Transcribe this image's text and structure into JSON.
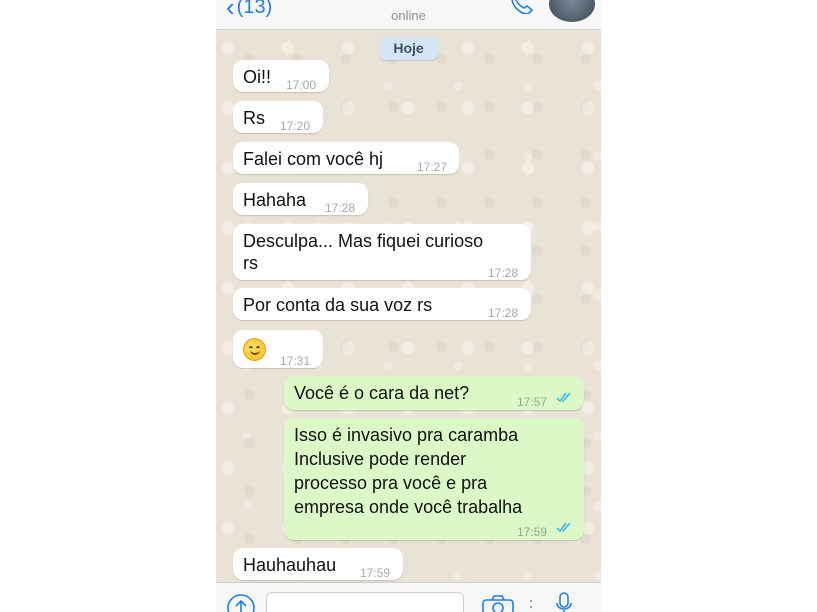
{
  "header": {
    "back_label": "(13)",
    "status": "online",
    "call_icon": "phone-icon",
    "avatar_icon": "contact-avatar"
  },
  "date_separator": "Hoje",
  "messages": [
    {
      "dir": "in",
      "lines": [
        "Oi!!"
      ],
      "time": "17:00"
    },
    {
      "dir": "in",
      "lines": [
        "Rs"
      ],
      "time": "17:20"
    },
    {
      "dir": "in",
      "lines": [
        "Falei com você hj"
      ],
      "time": "17:27"
    },
    {
      "dir": "in",
      "lines": [
        "Hahaha"
      ],
      "time": "17:28"
    },
    {
      "dir": "in",
      "lines": [
        "Desculpa... Mas fiquei curioso",
        "rs"
      ],
      "time": "17:28"
    },
    {
      "dir": "in",
      "lines": [
        "Por conta da sua voz rs"
      ],
      "time": "17:28"
    },
    {
      "dir": "in",
      "emoji": "smiling-face",
      "time": "17:31"
    },
    {
      "dir": "out",
      "lines": [
        "Você é o cara da net?"
      ],
      "time": "17:57",
      "read": true
    },
    {
      "dir": "out",
      "lines": [
        "Isso é invasivo pra caramba",
        "Inclusive pode render",
        "processo pra você e pra",
        "empresa onde você trabalha"
      ],
      "time": "17:59",
      "read": true
    },
    {
      "dir": "in",
      "lines": [
        "Hauhauhau"
      ],
      "time": "17:59"
    }
  ],
  "input_bar": {
    "upload_icon": "upload-icon",
    "message_placeholder": "",
    "camera_icon": "camera-icon",
    "mic_icon": "microphone-icon"
  },
  "colors": {
    "accent": "#1f7cf4",
    "outgoing_bubble": "#dcf8c6",
    "incoming_bubble": "#ffffff",
    "read_ticks": "#34b7f1",
    "chat_background": "#e9e2d6"
  }
}
